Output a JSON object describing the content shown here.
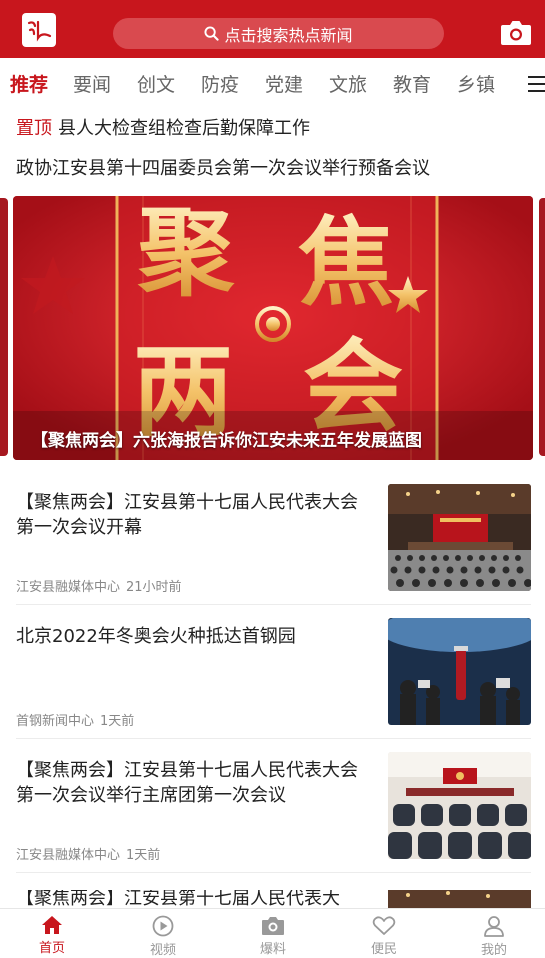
{
  "header": {
    "logo_icon": "jiangan-logo-icon",
    "search_placeholder": "点击搜索热点新闻",
    "camera_icon": "camera-icon"
  },
  "tabs": [
    {
      "label": "推荐",
      "active": true
    },
    {
      "label": "要闻"
    },
    {
      "label": "创文"
    },
    {
      "label": "防疫"
    },
    {
      "label": "党建"
    },
    {
      "label": "文旅"
    },
    {
      "label": "教育"
    },
    {
      "label": "乡镇"
    }
  ],
  "headlines": {
    "pinned": {
      "tag": "置顶",
      "title": "县人大检查组检查后勤保障工作"
    },
    "second": "政协江安县第十四届委员会第一次会议举行预备会议"
  },
  "carousel": {
    "poster_text_1": "聚",
    "poster_text_2": "焦",
    "poster_text_3": "两",
    "poster_text_4": "会",
    "caption": "【聚焦两会】六张海报告诉你江安未来五年发展蓝图"
  },
  "news": [
    {
      "title": "【聚焦两会】江安县第十七届人民代表大会第一次会议开幕",
      "source": "江安县融媒体中心",
      "time": "21小时前",
      "thumb": "auditorium"
    },
    {
      "title": "北京2022年冬奥会火种抵达首钢园",
      "source": "首钢新闻中心",
      "time": "1天前",
      "thumb": "torch"
    },
    {
      "title": "【聚焦两会】江安县第十七届人民代表大会第一次会议举行主席团第一次会议",
      "source": "江安县融媒体中心",
      "time": "1天前",
      "thumb": "meeting"
    },
    {
      "title": "【聚焦两会】江安县第十七届人民代表大",
      "source": "",
      "time": "",
      "thumb": "auditorium"
    }
  ],
  "bottom_nav": [
    {
      "label": "首页",
      "icon": "home-icon",
      "active": true
    },
    {
      "label": "视频",
      "icon": "play-icon"
    },
    {
      "label": "爆料",
      "icon": "camera-icon"
    },
    {
      "label": "便民",
      "icon": "heart-icon"
    },
    {
      "label": "我的",
      "icon": "user-icon"
    }
  ],
  "colors": {
    "brand": "#c8161d",
    "text": "#222222",
    "muted": "#888888"
  }
}
